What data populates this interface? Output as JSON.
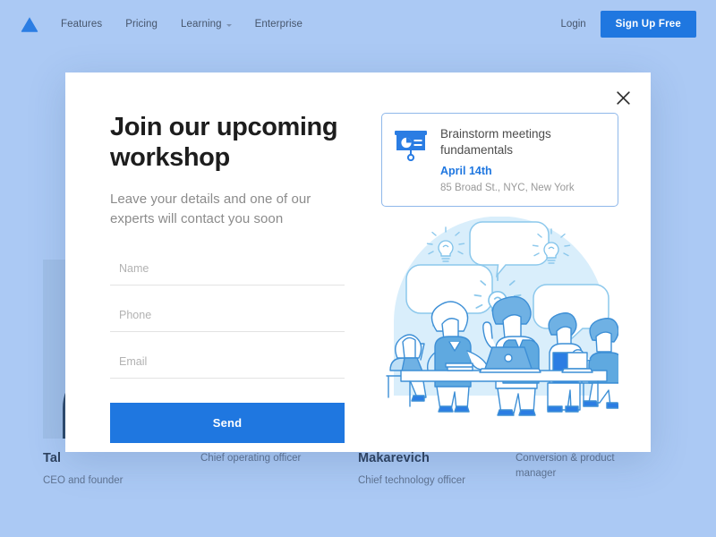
{
  "colors": {
    "page_background": "#abc9f4",
    "accent_blue": "#1f77e0",
    "modal_background": "#ffffff",
    "card_border": "#8fb8ea",
    "illustration_light": "#d9eefb"
  },
  "navbar": {
    "logo_icon": "triangle-logo-icon",
    "links": [
      {
        "label": "Features",
        "has_dropdown": false
      },
      {
        "label": "Pricing",
        "has_dropdown": false
      },
      {
        "label": "Learning",
        "has_dropdown": true
      },
      {
        "label": "Enterprise",
        "has_dropdown": false
      }
    ],
    "login_label": "Login",
    "signup_label": "Sign Up Free"
  },
  "team_section": {
    "members": [
      {
        "name": "Tal",
        "role": "CEO and founder"
      },
      {
        "name": "",
        "role": "Chief operating officer"
      },
      {
        "name": "Makarevich",
        "role": "Chief technology officer"
      },
      {
        "name": "",
        "role": "Conversion & product manager"
      }
    ]
  },
  "modal": {
    "close_icon": "close-icon",
    "title": "Join our upcoming workshop",
    "subtitle": "Leave your details and one of our experts will contact you soon",
    "form": {
      "fields": [
        {
          "name": "name",
          "placeholder": "Name",
          "value": ""
        },
        {
          "name": "phone",
          "placeholder": "Phone",
          "value": ""
        },
        {
          "name": "email",
          "placeholder": "Email",
          "value": ""
        }
      ],
      "submit_label": "Send"
    },
    "event_card": {
      "icon": "presentation-board-icon",
      "title": "Brainstorm meetings fundamentals",
      "date": "April 14th",
      "address": "85 Broad St., NYC, New York"
    },
    "illustration": {
      "name": "brainstorm-meeting-illustration",
      "description": "Five people at a conference table with speech bubbles and lightbulbs"
    }
  }
}
